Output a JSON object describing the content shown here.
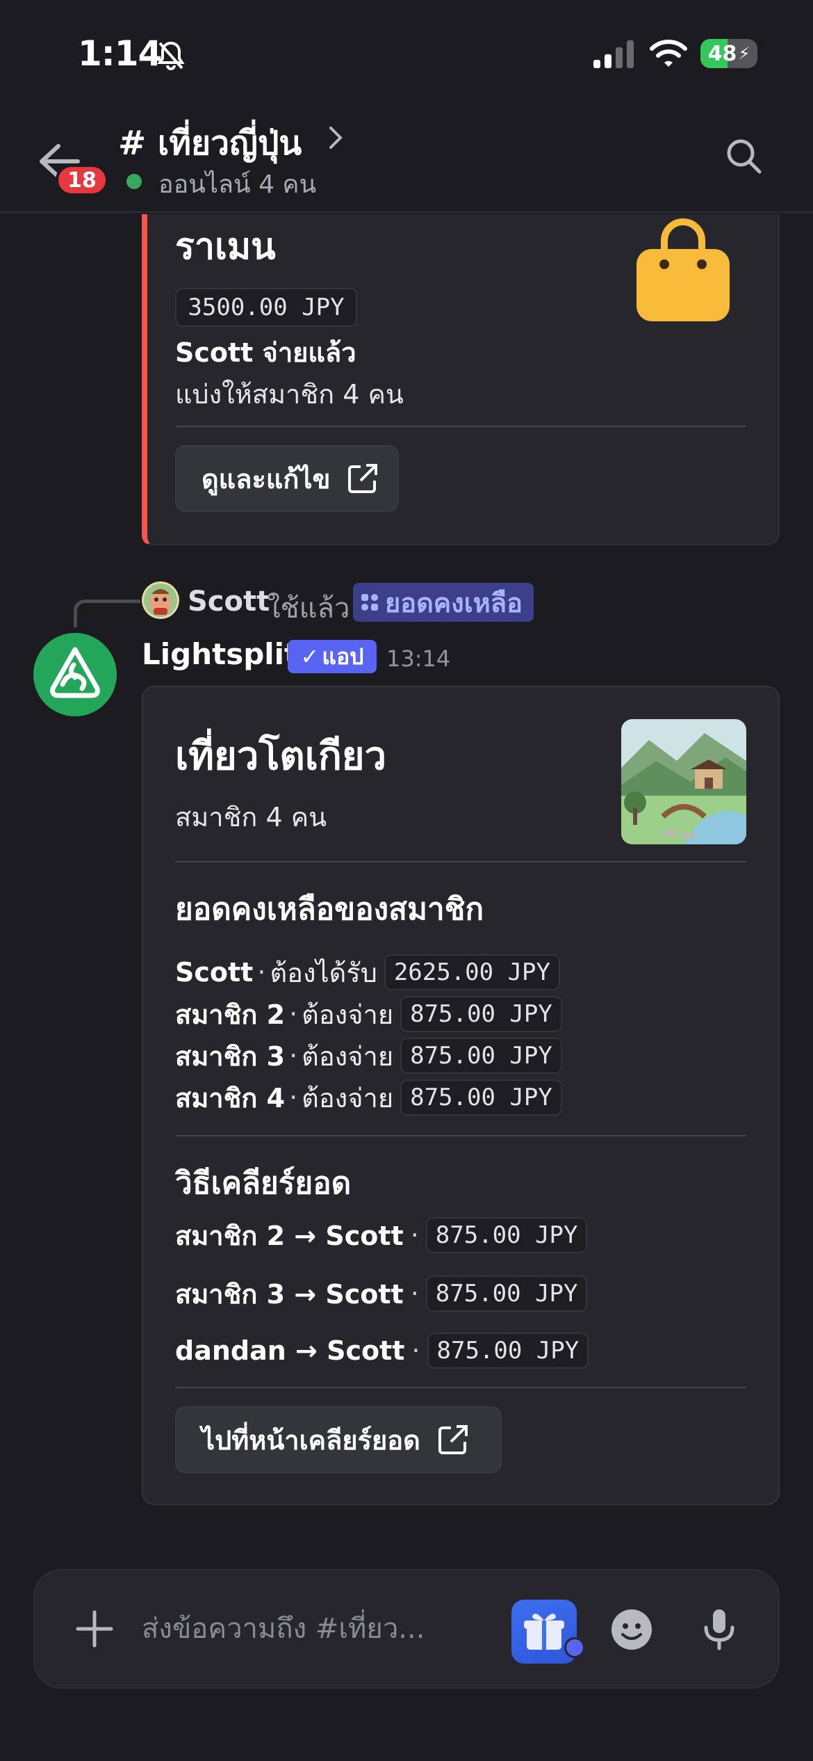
{
  "status_bar": {
    "time": "1:14",
    "battery": "48",
    "battery_level_percent": 48,
    "icons": [
      "bell-off-icon",
      "signal-icon",
      "wifi-icon",
      "battery-charging-icon"
    ]
  },
  "header": {
    "channel_title": "# เที่ยวญี่ปุ่น",
    "online_status": "ออนไลน์ 4 คน",
    "unread_badge": "18",
    "colors": {
      "online": "#3ba55d",
      "badge": "#e5383f"
    }
  },
  "embed_expense": {
    "title": "ราเมน",
    "amount": "3500.00 JPY",
    "paid_by": "Scott จ่ายแล้ว",
    "split": "แบ่งให้สมาชิก 4 คน",
    "button_label": "ดูและแก้ไข",
    "accent_color": "#f0574e",
    "icon": "shopping-bag-icon"
  },
  "reply": {
    "user": "Scott",
    "verb": "ใช้แล้ว",
    "command": "ยอดคงเหลือ"
  },
  "message": {
    "bot_name": "Lightsplit",
    "app_tag": "แอป",
    "time": "13:14"
  },
  "embed_balance": {
    "title": "เที่ยวโตเกียว",
    "members": "สมาชิก 4 คน",
    "balances_heading": "ยอดคงเหลือของสมาชิก",
    "balances": [
      {
        "name": "Scott",
        "sep": "·",
        "action": "ต้องได้รับ",
        "amount": "2625.00 JPY"
      },
      {
        "name": "สมาชิก 2",
        "sep": "·",
        "action": "ต้องจ่าย",
        "amount": "875.00 JPY"
      },
      {
        "name": "สมาชิก 3",
        "sep": "·",
        "action": "ต้องจ่าย",
        "amount": "875.00 JPY"
      },
      {
        "name": "สมาชิก 4",
        "sep": "·",
        "action": "ต้องจ่าย",
        "amount": "875.00 JPY"
      }
    ],
    "settle_heading": "วิธีเคลียร์ยอด",
    "settlements": [
      {
        "path": "สมาชิก 2 → Scott",
        "sep": "·",
        "amount": "875.00 JPY"
      },
      {
        "path": "สมาชิก 3 → Scott",
        "sep": "·",
        "amount": "875.00 JPY"
      },
      {
        "path": "dandan → Scott",
        "sep": "·",
        "amount": "875.00 JPY"
      }
    ],
    "button_label": "ไปที่หน้าเคลียร์ยอด"
  },
  "composer": {
    "placeholder": "ส่งข้อความถึง #เที่ยว..."
  }
}
